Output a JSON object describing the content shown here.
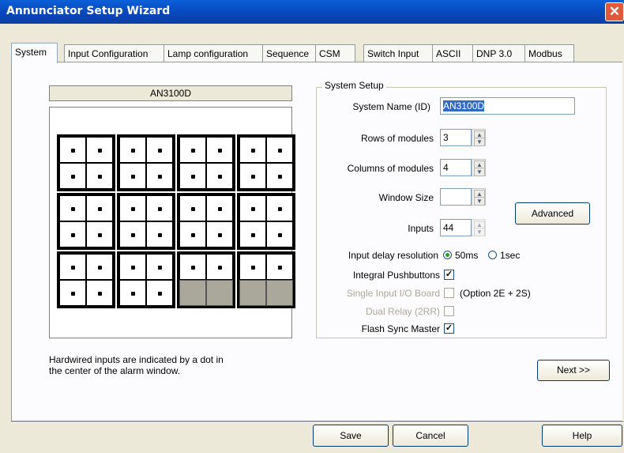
{
  "window": {
    "title": "Annunciator Setup Wizard",
    "close_icon": "close-icon"
  },
  "tabs": [
    "System",
    "Input Configuration",
    "Lamp configuration",
    "Sequence",
    "CSM",
    "Switch Input",
    "ASCII",
    "DNP 3.0",
    "Modbus"
  ],
  "active_tab": "System",
  "device": {
    "name": "AN3100D",
    "rows": 3,
    "columns": 4,
    "inputs": 44
  },
  "hint": [
    "Hardwired inputs are indicated by a dot in",
    "the center of the alarm window."
  ],
  "system_setup": {
    "group_title": "System Setup",
    "system_name_label": "System Name (ID)",
    "system_name_value": "AN3100D",
    "rows_label": "Rows of modules",
    "rows_value": "3",
    "columns_label": "Columns of modules",
    "columns_value": "4",
    "window_size_label": "Window Size",
    "window_size_value": "",
    "inputs_label": "Inputs",
    "inputs_value": "44",
    "advanced_label": "Advanced",
    "input_delay_label": "Input delay resolution",
    "delay_option_1": "50ms",
    "delay_option_2": "1sec",
    "delay_selected": "50ms",
    "integral_pushbuttons_label": "Integral Pushbuttons",
    "integral_pushbuttons_checked": true,
    "single_input_label": "Single Input I/O Board",
    "single_input_note": "(Option 2E + 2S)",
    "dual_relay_label": "Dual Relay (2RR)",
    "flash_sync_label": "Flash Sync Master",
    "flash_sync_checked": true
  },
  "buttons": {
    "next": "Next >>",
    "save": "Save",
    "cancel": "Cancel",
    "help": "Help"
  }
}
